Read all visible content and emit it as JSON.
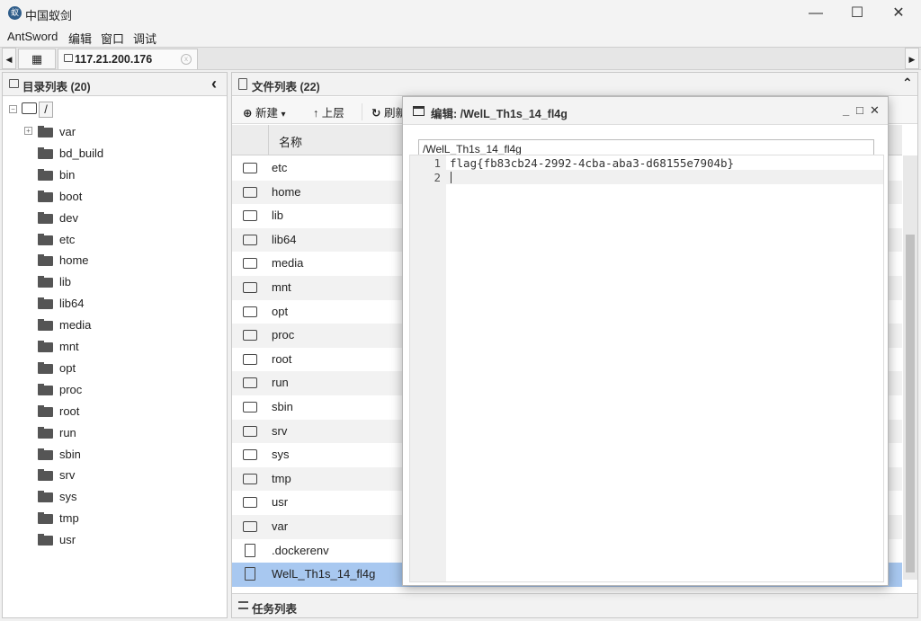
{
  "window": {
    "title": "中国蚁剑",
    "minimize": "—",
    "maximize": "☐",
    "close": "✕"
  },
  "menu": [
    "AntSword",
    "编辑",
    "窗口",
    "调试"
  ],
  "tabs": {
    "left_arrow": "◀",
    "right_arrow": "▶",
    "home_icon": "▦",
    "connection": "117.21.200.176",
    "close_icon": "ⓧ"
  },
  "dir_panel": {
    "title": "目录列表 (20)",
    "collapse": "‹",
    "root": "/",
    "items": [
      "var",
      "bd_build",
      "bin",
      "boot",
      "dev",
      "etc",
      "home",
      "lib",
      "lib64",
      "media",
      "mnt",
      "opt",
      "proc",
      "root",
      "run",
      "sbin",
      "srv",
      "sys",
      "tmp",
      "usr"
    ]
  },
  "file_panel": {
    "title": "文件列表 (22)",
    "collapse": "⌃",
    "toolbar": {
      "new": "新建",
      "up": "上层",
      "refresh": "刷新"
    },
    "column_name": "名称",
    "files": [
      {
        "name": "etc",
        "type": "folder"
      },
      {
        "name": "home",
        "type": "folder"
      },
      {
        "name": "lib",
        "type": "folder"
      },
      {
        "name": "lib64",
        "type": "folder"
      },
      {
        "name": "media",
        "type": "folder"
      },
      {
        "name": "mnt",
        "type": "folder"
      },
      {
        "name": "opt",
        "type": "folder"
      },
      {
        "name": "proc",
        "type": "folder"
      },
      {
        "name": "root",
        "type": "folder"
      },
      {
        "name": "run",
        "type": "folder"
      },
      {
        "name": "sbin",
        "type": "folder"
      },
      {
        "name": "srv",
        "type": "folder"
      },
      {
        "name": "sys",
        "type": "folder"
      },
      {
        "name": "tmp",
        "type": "folder"
      },
      {
        "name": "usr",
        "type": "folder"
      },
      {
        "name": "var",
        "type": "folder"
      },
      {
        "name": ".dockerenv",
        "type": "file"
      },
      {
        "name": "WelL_Th1s_14_fl4g",
        "type": "file"
      }
    ],
    "selected": "WelL_Th1s_14_fl4g",
    "task_title": "任务列表"
  },
  "editor": {
    "title": "编辑: /WelL_Th1s_14_fl4g",
    "path": "/WelL_Th1s_14_fl4g",
    "controls": [
      "_",
      "□",
      "✕"
    ],
    "lines": [
      {
        "no": "1",
        "text": "flag{fb83cb24-2992-4cba-aba3-d68155e7904b}"
      },
      {
        "no": "2",
        "text": ""
      }
    ]
  }
}
